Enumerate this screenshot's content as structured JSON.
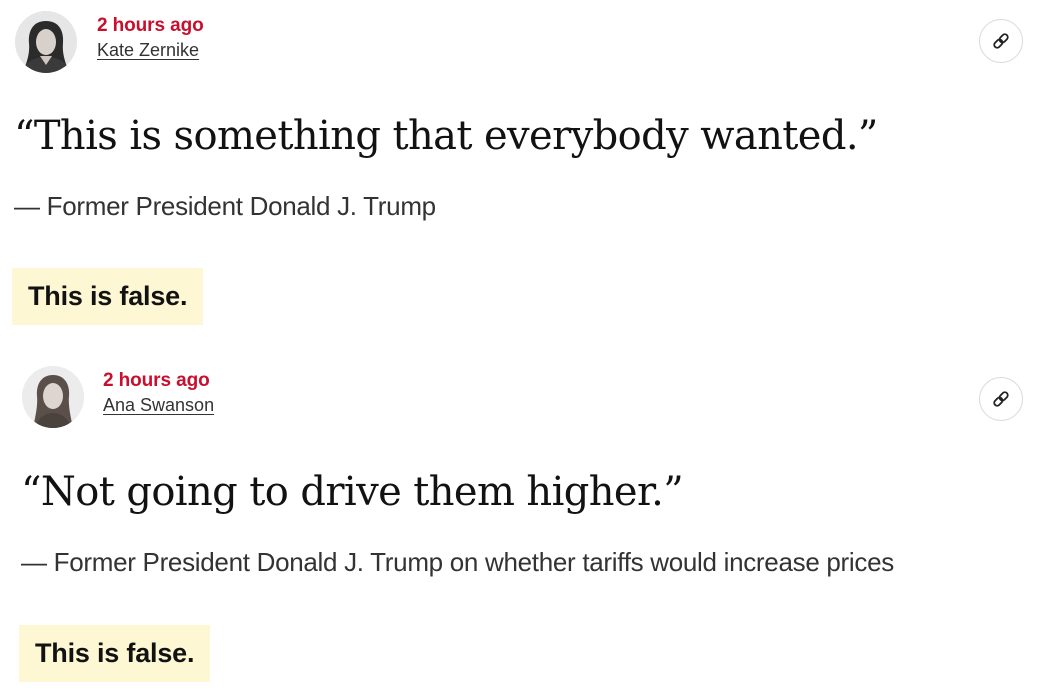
{
  "posts": [
    {
      "timestamp": "2 hours ago",
      "author": "Kate Zernike",
      "quote": "“This is something that everybody wanted.”",
      "attribution": "— Former President Donald J. Trump",
      "verdict": "This is false.",
      "share_icon": "link-icon"
    },
    {
      "timestamp": "2 hours ago",
      "author": "Ana Swanson",
      "quote": "“Not going to drive them higher.”",
      "attribution": "— Former President Donald J. Trump on whether tariffs would increase prices",
      "verdict": "This is false.",
      "share_icon": "link-icon"
    }
  ],
  "colors": {
    "timestamp": "#c8102e",
    "verdict_background": "#fdf7d4",
    "text": "#121212"
  }
}
